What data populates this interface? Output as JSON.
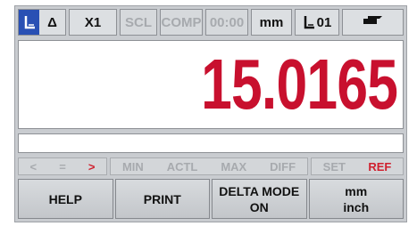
{
  "status_bar": {
    "mode_active_icon": "reference-datum-icon",
    "mode_delta_symbol": "Δ",
    "axis": "X1",
    "scl": "SCL",
    "comp": "COMP",
    "time": "00:00",
    "unit": "mm",
    "datum_label": "01",
    "datum_icon": "datum-icon",
    "tool_icon": "tool-icon"
  },
  "display": {
    "value": "15.0165",
    "message": ""
  },
  "indicators": {
    "compare": [
      "<",
      "=",
      ">"
    ],
    "compare_active_index": 2,
    "measure": [
      "MIN",
      "ACTL",
      "MAX",
      "DIFF"
    ],
    "set_label": "SET",
    "ref_label": "REF"
  },
  "softkeys": [
    {
      "line1": "HELP",
      "line2": ""
    },
    {
      "line1": "PRINT",
      "line2": ""
    },
    {
      "line1": "DELTA MODE",
      "line2": "ON"
    },
    {
      "line1": "mm",
      "line2": "inch"
    }
  ],
  "colors": {
    "display_value": "#c8102e",
    "mode_active_bg": "#2950b4",
    "ref_active": "#d0202e"
  }
}
